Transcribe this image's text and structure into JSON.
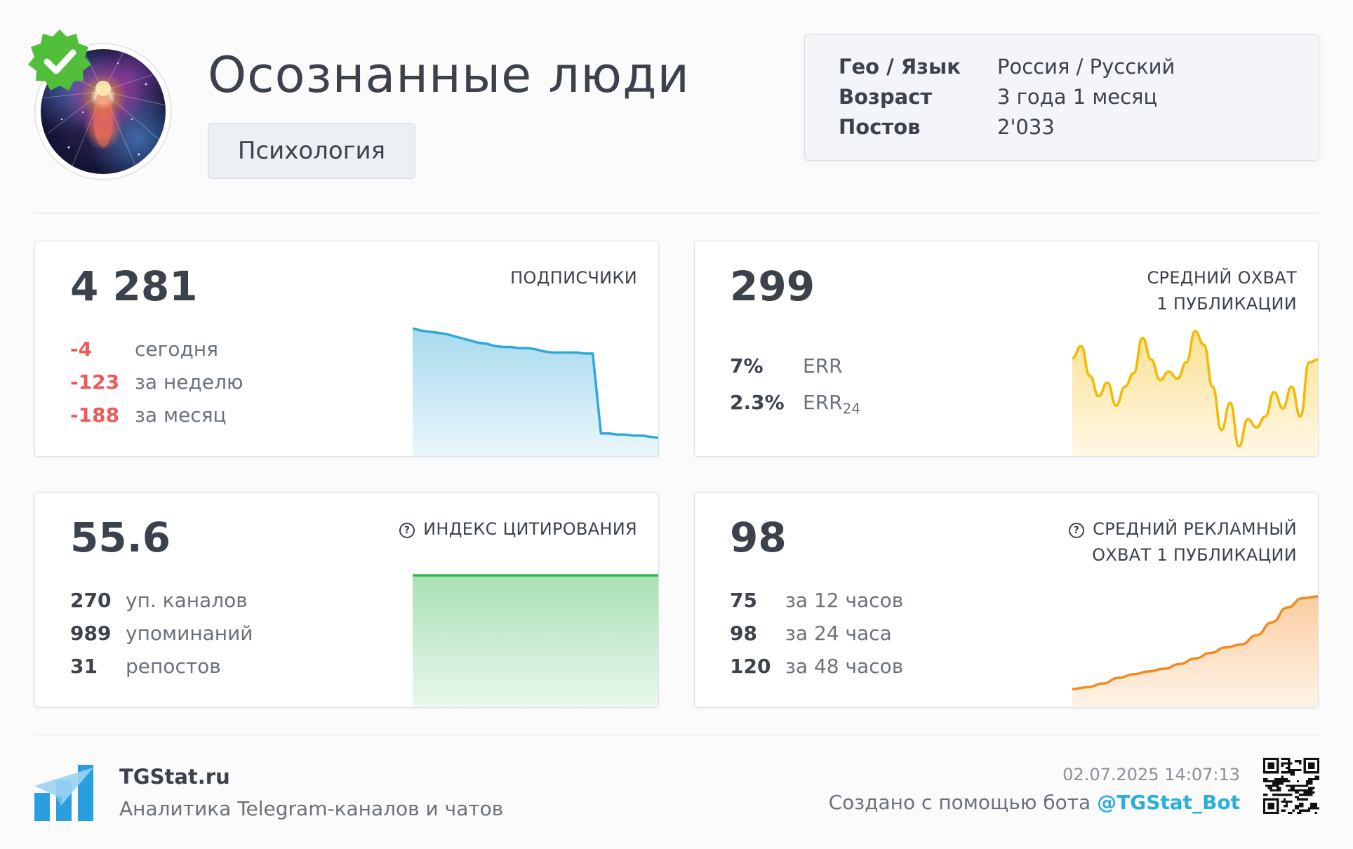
{
  "header": {
    "title": "Осознанные люди",
    "category": "Психология",
    "avatar_icon": "avatar-image",
    "verified_icon": "verified-badge-icon"
  },
  "info": [
    {
      "key": "Гео / Язык",
      "value": "Россия / Русский"
    },
    {
      "key": "Возраст",
      "value": "3 года 1 месяц"
    },
    {
      "key": "Постов",
      "value": "2'033"
    }
  ],
  "cards": {
    "subscribers": {
      "value": "4 281",
      "label": "ПОДПИСЧИКИ",
      "stats": [
        {
          "num": "-4",
          "text": "сегодня"
        },
        {
          "num": "-123",
          "text": "за неделю"
        },
        {
          "num": "-188",
          "text": "за месяц"
        }
      ],
      "color": "#2fa8d8",
      "sparkline": [
        100,
        98,
        97,
        96,
        95,
        93,
        91,
        89,
        87,
        86,
        84,
        83,
        83,
        82,
        82,
        81,
        79,
        78,
        78,
        78,
        78,
        77,
        77,
        4,
        4,
        3,
        3,
        2,
        2,
        1,
        0
      ]
    },
    "reach": {
      "value": "299",
      "label_line1": "СРЕДНИЙ ОХВАТ",
      "label_line2": "1 ПУБЛИКАЦИИ",
      "err_value": "7%",
      "err_label": "ERR",
      "err24_value": "2.3%",
      "err24_label": "ERR",
      "err24_sub": "24",
      "color": "#f5b800",
      "sparkline": [
        73,
        82,
        60,
        45,
        55,
        38,
        52,
        62,
        88,
        72,
        57,
        63,
        58,
        70,
        93,
        83,
        52,
        20,
        40,
        8,
        28,
        22,
        30,
        48,
        36,
        52,
        30,
        70,
        72
      ]
    },
    "citation": {
      "value": "55.6",
      "label": "ИНДЕКС ЦИТИРОВАНИЯ",
      "stats": [
        {
          "num": "270",
          "text": "уп. каналов"
        },
        {
          "num": "989",
          "text": "упоминаний"
        },
        {
          "num": "31",
          "text": "репостов"
        }
      ],
      "color": "#2fb84e",
      "sparkline": [
        50,
        50,
        50,
        50,
        50,
        50,
        50,
        50,
        50,
        50
      ]
    },
    "ad_reach": {
      "value": "98",
      "label_line1": "СРЕДНИЙ РЕКЛАМНЫЙ",
      "label_line2": "ОХВАТ 1 ПУБЛИКАЦИИ",
      "stats": [
        {
          "num": "75",
          "text": "за 12 часов"
        },
        {
          "num": "98",
          "text": "за 24 часа"
        },
        {
          "num": "120",
          "text": "за 48 часов"
        }
      ],
      "color": "#f5891f",
      "sparkline": [
        0,
        2,
        6,
        12,
        16,
        19,
        22,
        27,
        33,
        39,
        45,
        48,
        58,
        72,
        88,
        98,
        100
      ]
    }
  },
  "footer": {
    "brand": "TGStat.ru",
    "tagline": "Аналитика Telegram-каналов и чатов",
    "timestamp": "02.07.2025 14:07:13",
    "made_with": "Создано с помощью бота ",
    "bot": "@TGStat_Bot"
  }
}
